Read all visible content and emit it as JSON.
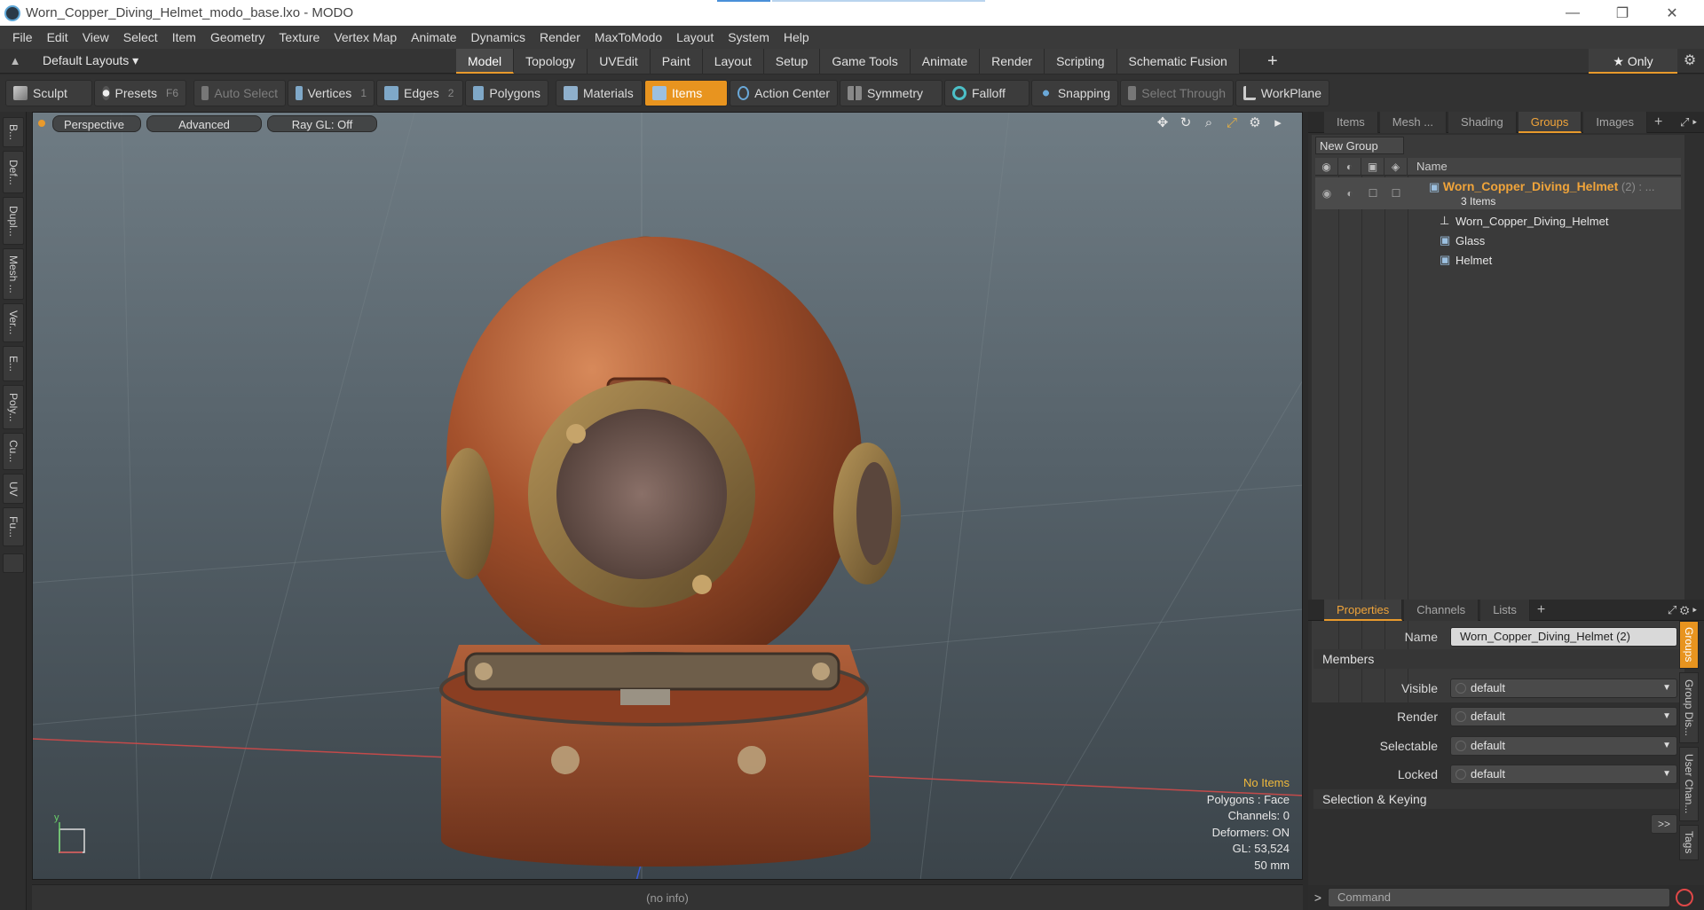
{
  "window": {
    "title": "Worn_Copper_Diving_Helmet_modo_base.lxo - MODO",
    "minimize": "—",
    "maximize": "❐",
    "close": "✕"
  },
  "menu": [
    "File",
    "Edit",
    "View",
    "Select",
    "Item",
    "Geometry",
    "Texture",
    "Vertex Map",
    "Animate",
    "Dynamics",
    "Render",
    "MaxToModo",
    "Layout",
    "System",
    "Help"
  ],
  "layoutbar": {
    "layouts_label": "Default Layouts ▾",
    "tabs": [
      "Model",
      "Topology",
      "UVEdit",
      "Paint",
      "Layout",
      "Setup",
      "Game Tools",
      "Animate",
      "Render",
      "Scripting",
      "Schematic Fusion"
    ],
    "active_tab": "Model",
    "only_label": "★  Only"
  },
  "toolbar": {
    "sculpt": "Sculpt",
    "presets": "Presets",
    "presets_key": "F6",
    "auto_select": "Auto Select",
    "vertices": "Vertices",
    "vertices_key": "1",
    "edges": "Edges",
    "edges_key": "2",
    "polygons": "Polygons",
    "materials": "Materials",
    "items": "Items",
    "action_center": "Action Center",
    "symmetry": "Symmetry",
    "falloff": "Falloff",
    "snapping": "Snapping",
    "select_through": "Select Through",
    "workplane": "WorkPlane"
  },
  "left_tabs": [
    "B...",
    "Def...",
    "Dupl...",
    "Mesh ...",
    "Ver...",
    "E...",
    "Poly...",
    "Cu...",
    "UV",
    "Fu..."
  ],
  "viewport": {
    "perspective": "Perspective",
    "advanced": "Advanced",
    "raygl": "Ray GL: Off",
    "info": {
      "items": "No Items",
      "polygons": "Polygons : Face",
      "channels": "Channels: 0",
      "deformers": "Deformers: ON",
      "gl": "GL: 53,524",
      "lens": "50 mm"
    },
    "axis_y": "y"
  },
  "status": "(no info)",
  "groups_panel": {
    "tabs": [
      "Items",
      "Mesh ...",
      "Shading",
      "Groups",
      "Images"
    ],
    "active_tab": "Groups",
    "new_group": "New Group",
    "name_header": "Name",
    "group": {
      "name": "Worn_Copper_Diving_Helmet",
      "suffix": "(2) : ...",
      "count": "3 Items"
    },
    "children": [
      "Worn_Copper_Diving_Helmet",
      "Glass",
      "Helmet"
    ]
  },
  "properties_panel": {
    "tabs": [
      "Properties",
      "Channels",
      "Lists"
    ],
    "active_tab": "Properties",
    "name_label": "Name",
    "name_value": "Worn_Copper_Diving_Helmet (2)",
    "members_section": "Members",
    "fields": [
      {
        "label": "Visible",
        "value": "default"
      },
      {
        "label": "Render",
        "value": "default"
      },
      {
        "label": "Selectable",
        "value": "default"
      },
      {
        "label": "Locked",
        "value": "default"
      }
    ],
    "selection_section": "Selection & Keying",
    "expand": ">>"
  },
  "right_vtabs": [
    "Groups",
    "Group Dis...",
    "User Chan...",
    "Tags"
  ],
  "command": {
    "prompt": ">",
    "placeholder": "Command"
  },
  "colors": {
    "accent": "#e8941f",
    "copper": "#a0502c",
    "brass": "#8a6a3a"
  }
}
